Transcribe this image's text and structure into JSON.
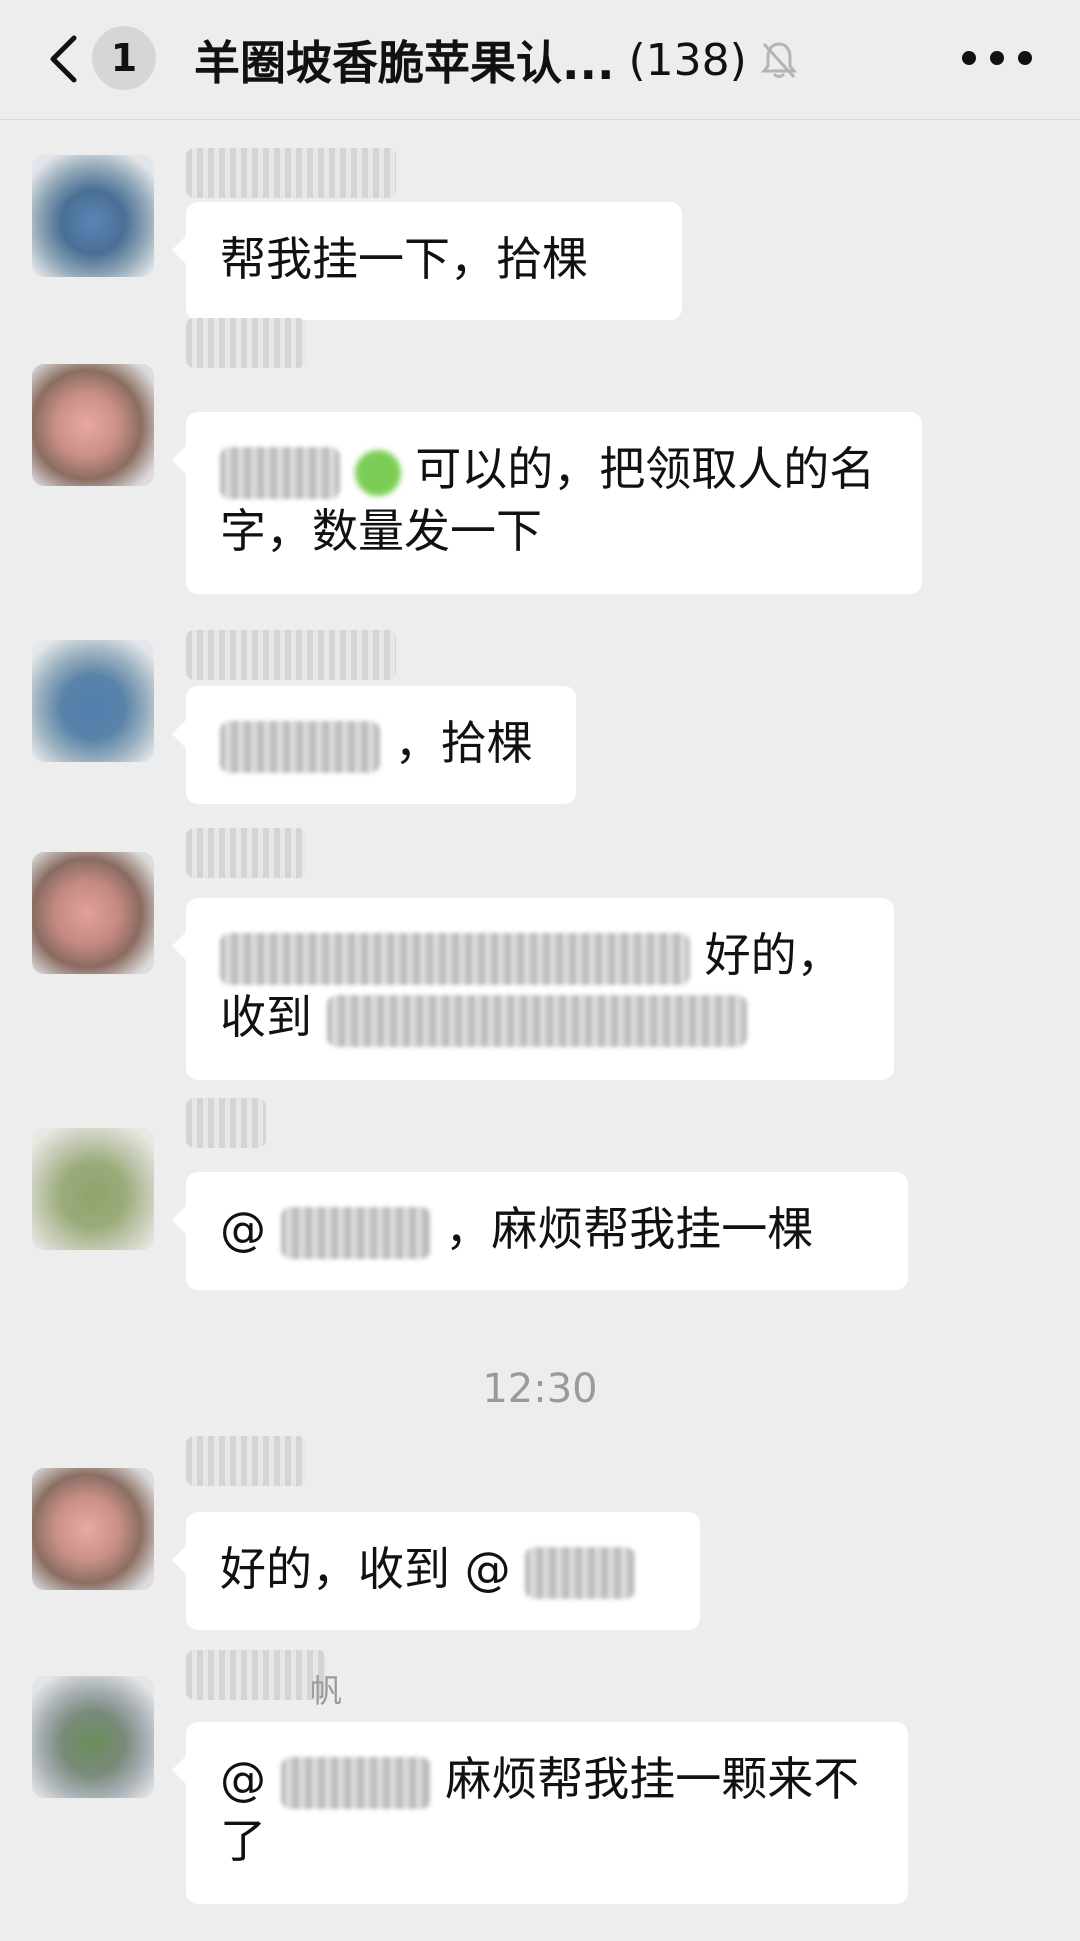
{
  "header": {
    "unread_count": "1",
    "title": "羊圈坡香脆苹果认...",
    "member_count": "(138)"
  },
  "messages": [
    {
      "bubble_text": "帮我挂一下，拾棵"
    },
    {
      "bubble_text": "可以的，把领取人的名字，数量发一下"
    },
    {
      "bubble_text": "，拾棵"
    },
    {
      "bubble_line1": "好的，",
      "bubble_line2": "收到"
    },
    {
      "at_sign": "@",
      "bubble_text": "，麻烦帮我挂一棵"
    },
    {
      "bubble_text": "好的，收到 @"
    },
    {
      "sender_suffix": "帆",
      "at_sign": "@",
      "bubble_text": "麻烦帮我挂一颗来不了"
    }
  ],
  "time_separator": "12:30",
  "colors": {
    "background": "#ededed",
    "bubble": "#ffffff",
    "time_text": "#9a9a9a"
  },
  "icons": {
    "back": "chevron-left-icon",
    "mute": "bell-off-icon",
    "more": "more-dots-icon"
  }
}
